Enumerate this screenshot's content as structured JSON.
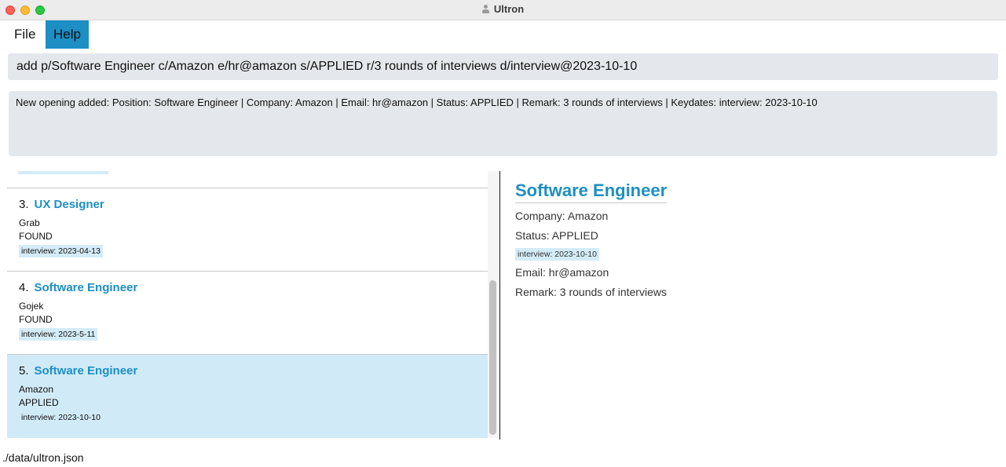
{
  "window": {
    "title": "Ultron"
  },
  "menu": {
    "file": "File",
    "help": "Help"
  },
  "command_box": {
    "value": "add p/Software Engineer c/Amazon e/hr@amazon s/APPLIED r/3 rounds of interviews d/interview@2023-10-10"
  },
  "result_box": {
    "text": "New opening added: Position: Software Engineer | Company: Amazon | Email: hr@amazon | Status: APPLIED | Remark: 3 rounds of interviews | Keydates: interview: 2023-10-10"
  },
  "openings": [
    {
      "index": "3.",
      "position": "UX Designer",
      "company": "Grab",
      "status": "FOUND",
      "keydate": "interview: 2023-04-13",
      "selected": false
    },
    {
      "index": "4.",
      "position": "Software Engineer",
      "company": "Gojek",
      "status": "FOUND",
      "keydate": "interview: 2023-5-11",
      "selected": false
    },
    {
      "index": "5.",
      "position": "Software Engineer",
      "company": "Amazon",
      "status": "APPLIED",
      "keydate": "interview: 2023-10-10",
      "selected": true
    }
  ],
  "detail": {
    "title": "Software Engineer",
    "company": "Company: Amazon",
    "status": "Status: APPLIED",
    "keydate": "interview: 2023-10-10",
    "email": "Email: hr@amazon",
    "remark": "Remark: 3 rounds of interviews"
  },
  "footer": {
    "path": "./data/ultron.json"
  },
  "colors": {
    "accent": "#1d8fc4",
    "selected_bg": "#d0eaf8",
    "tag_bg": "#d3ecf8",
    "panel_bg": "#e4e7eb"
  }
}
